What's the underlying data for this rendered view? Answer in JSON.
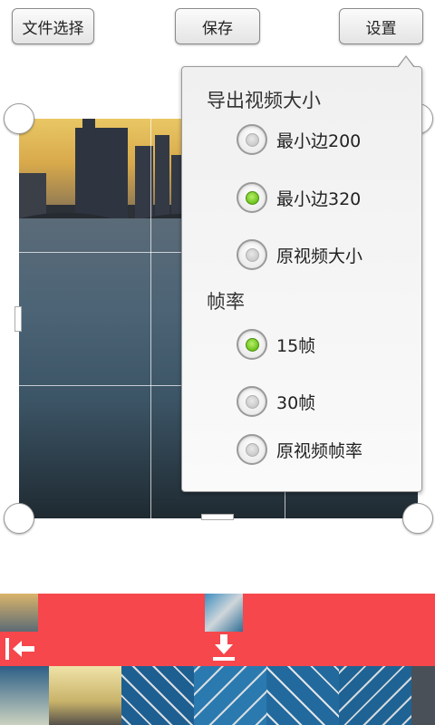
{
  "toolbar": {
    "file_select": "文件选择",
    "save": "保存",
    "settings": "设置"
  },
  "settings_popup": {
    "size_title": "导出视频大小",
    "size_options": [
      {
        "label": "最小边200",
        "selected": false
      },
      {
        "label": "最小边320",
        "selected": true
      },
      {
        "label": "原视频大小",
        "selected": false
      }
    ],
    "framerate_title": "帧率",
    "framerate_options": [
      {
        "label": "15帧",
        "selected": true
      },
      {
        "label": "30帧",
        "selected": false
      },
      {
        "label": "原视频帧率",
        "selected": false
      }
    ]
  },
  "colors": {
    "timeline_accent": "#f5474c",
    "radio_selected": "#6cc21c"
  },
  "icons": {
    "range_start": "arrow-left-to-bar-icon",
    "current_position": "arrow-down-icon"
  }
}
